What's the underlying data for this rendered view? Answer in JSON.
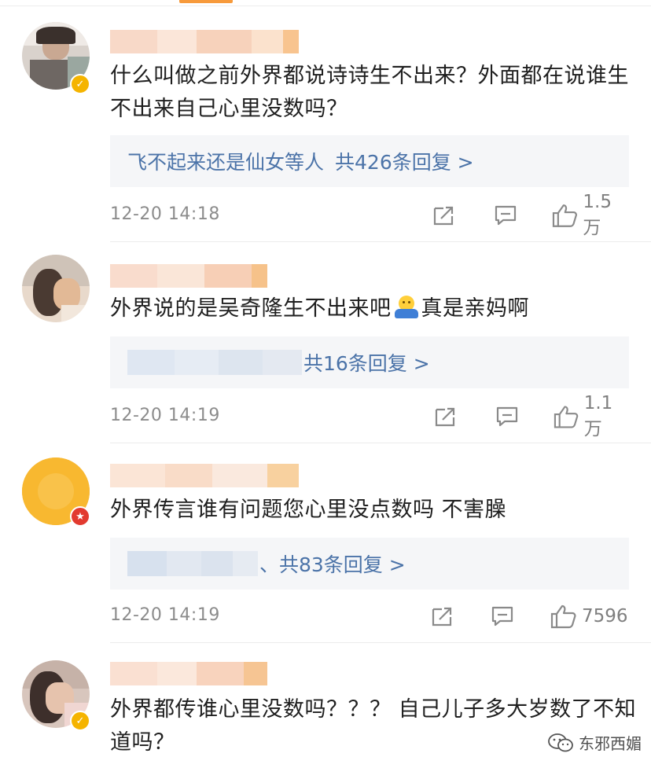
{
  "comments": [
    {
      "text": "什么叫做之前外界都说诗诗生不出来？外面都在说谁生不出来自己心里没数吗？",
      "reply_user": "飞不起来还是仙女等人",
      "reply_count": "共426条回复 >",
      "time": "12-20 14:18",
      "likes": "1.5万",
      "badge": "verified"
    },
    {
      "text_before": "外界说的是吴奇隆生不出来吧",
      "emoji": "shrug-emoji",
      "text_after": "真是亲妈啊",
      "reply_user": "",
      "reply_count": "共16条回复 >",
      "time": "12-20 14:19",
      "likes": "1.1万",
      "badge": "none"
    },
    {
      "text": "外界传言谁有问题您心里没点数吗 不害臊",
      "reply_user": "",
      "reply_count": "、共83条回复 >",
      "time": "12-20 14:19",
      "likes": "7596",
      "badge": "star"
    },
    {
      "text": "外界都传谁心里没数吗？？？ 自己儿子多大岁数了不知道吗？",
      "badge": "verified"
    }
  ],
  "watermark": "东邪西媚",
  "colors": {
    "accent": "#f79a3b",
    "link": "#4b73a8",
    "verified_badge": "#f5b400",
    "star_badge": "#e23a2f",
    "reply_bg": "#f5f6f8"
  },
  "icons": [
    "share-icon",
    "comment-icon",
    "thumbs-up-icon",
    "verified-badge-icon",
    "star-badge-icon",
    "wechat-icon"
  ]
}
